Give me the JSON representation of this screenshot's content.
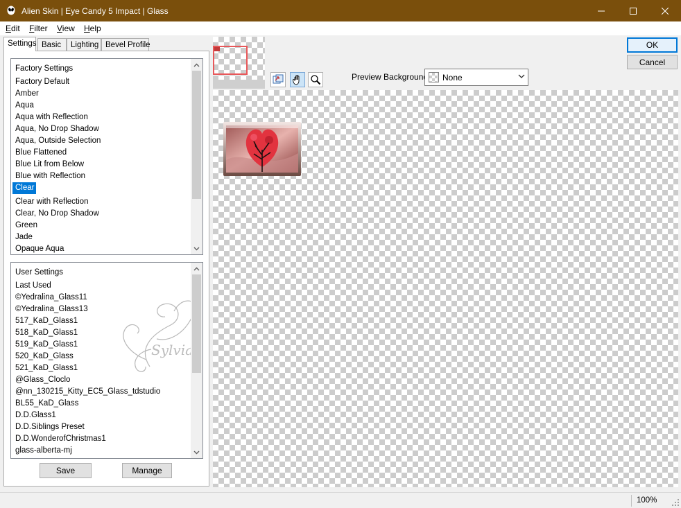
{
  "window": {
    "title": "Alien Skin | Eye Candy 5 Impact | Glass",
    "app_icon": "alien-skin-icon",
    "controls": [
      "minimize-icon",
      "maximize-icon",
      "close-icon"
    ]
  },
  "menu": [
    {
      "accel": "E",
      "rest": "dit"
    },
    {
      "accel": "F",
      "rest": "ilter"
    },
    {
      "accel": "V",
      "rest": "iew"
    },
    {
      "accel": "H",
      "rest": "elp"
    }
  ],
  "tabs": [
    "Settings",
    "Basic",
    "Lighting",
    "Bevel Profile"
  ],
  "active_tab": "Settings",
  "factory_settings": {
    "header": "Factory Settings",
    "items": [
      "Factory Default",
      "Amber",
      "Aqua",
      "Aqua with Reflection",
      "Aqua, No Drop Shadow",
      "Aqua, Outside Selection",
      "Blue Flattened",
      "Blue Lit from Below",
      "Blue with Reflection",
      "Clear",
      "Clear with Reflection",
      "Clear, No Drop Shadow",
      "Green",
      "Jade",
      "Opaque Aqua"
    ],
    "selected": "Clear"
  },
  "user_settings": {
    "header": "User Settings",
    "items": [
      "Last Used",
      "©Yedralina_Glass11",
      "©Yedralina_Glass13",
      "517_KaD_Glass1",
      "518_KaD_Glass1",
      "519_KaD_Glass1",
      "520_KaD_Glass",
      "521_KaD_Glass1",
      "@Glass_Cloclo",
      "@nn_130215_Kitty_EC5_Glass_tdstudio",
      "BL55_KaD_Glass",
      "D.D.Glass1",
      "D.D.Siblings Preset",
      "D.D.WonderofChristmas1",
      "glass-alberta-mj"
    ]
  },
  "watermark": "Sylviane",
  "buttons": {
    "save": "Save",
    "manage": "Manage",
    "ok": "OK",
    "cancel": "Cancel"
  },
  "preview_background": {
    "label": "Preview Background:",
    "value": "None"
  },
  "tools": [
    "navigate-preview-icon",
    "hand-tool-icon",
    "zoom-tool-icon"
  ],
  "status": {
    "zoom": "100%"
  },
  "colors": {
    "titlebar": "#7a4f0c",
    "selection": "#0078d7",
    "nav_rect": "#e8585a"
  }
}
